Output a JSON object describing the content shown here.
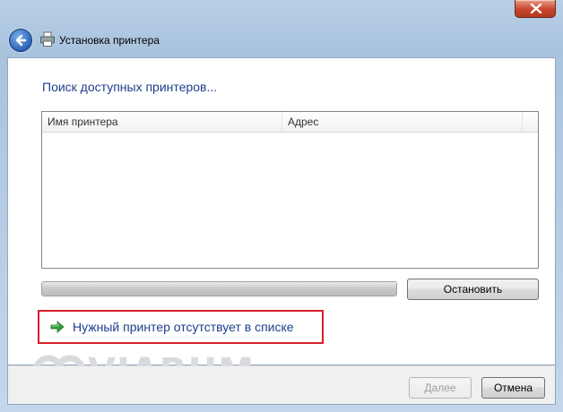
{
  "window": {
    "title": "Установка принтера"
  },
  "main": {
    "heading": "Поиск доступных принтеров...",
    "list": {
      "columns": [
        "Имя принтера",
        "Адрес"
      ],
      "rows": []
    },
    "progress": 1.0,
    "stop_button": "Остановить",
    "missing_printer_link": "Нужный принтер отсутствует в списке"
  },
  "watermark": "VIARUM",
  "footer": {
    "next_button": "Далее",
    "cancel_button": "Отмена"
  },
  "colors": {
    "heading": "#1e3e8c",
    "highlight_border": "#d81e2c",
    "arrow_green": "#2e9e3a"
  },
  "icons": {
    "back": "back-arrow-icon",
    "printer": "printer-icon",
    "close": "close-icon",
    "arrow": "green-arrow-icon",
    "watermark_logo": "viarum-logo-icon"
  }
}
